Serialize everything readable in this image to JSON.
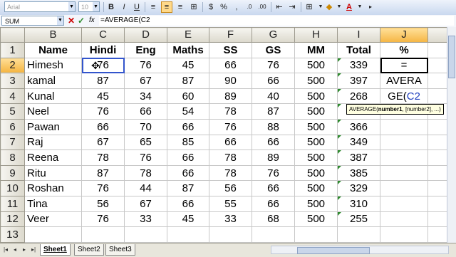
{
  "toolbar": {
    "font_name": "Arial",
    "font_size": "10",
    "bold": "B",
    "italic": "I",
    "underline": "U",
    "percent": "%",
    "comma": ",",
    "font_color_letter": "A"
  },
  "formula_bar": {
    "name_box": "SUM",
    "cancel": "✕",
    "enter": "✓",
    "fx": "fx",
    "formula": "=AVERAGE(C2"
  },
  "grid": {
    "columns": [
      "B",
      "C",
      "D",
      "E",
      "F",
      "G",
      "H",
      "I",
      "J"
    ],
    "headers": [
      "Name",
      "Hindi",
      "Eng",
      "Maths",
      "SS",
      "GS",
      "MM",
      "Total",
      "%"
    ],
    "rows": [
      {
        "num": "2",
        "name": "Himesh",
        "hindi": "76",
        "eng": "76",
        "maths": "45",
        "ss": "66",
        "gs": "76",
        "mm": "500",
        "total": "339"
      },
      {
        "num": "3",
        "name": "kamal",
        "hindi": "87",
        "eng": "67",
        "maths": "87",
        "ss": "90",
        "gs": "66",
        "mm": "500",
        "total": "397"
      },
      {
        "num": "4",
        "name": "Kunal",
        "hindi": "45",
        "eng": "34",
        "maths": "60",
        "ss": "89",
        "gs": "40",
        "mm": "500",
        "total": "268"
      },
      {
        "num": "5",
        "name": "Neel",
        "hindi": "76",
        "eng": "66",
        "maths": "54",
        "ss": "78",
        "gs": "87",
        "mm": "500",
        "total": ""
      },
      {
        "num": "6",
        "name": "Pawan",
        "hindi": "66",
        "eng": "70",
        "maths": "66",
        "ss": "76",
        "gs": "88",
        "mm": "500",
        "total": "366"
      },
      {
        "num": "7",
        "name": "Raj",
        "hindi": "67",
        "eng": "65",
        "maths": "85",
        "ss": "66",
        "gs": "66",
        "mm": "500",
        "total": "349"
      },
      {
        "num": "8",
        "name": "Reena",
        "hindi": "78",
        "eng": "76",
        "maths": "66",
        "ss": "78",
        "gs": "89",
        "mm": "500",
        "total": "387"
      },
      {
        "num": "9",
        "name": "Ritu",
        "hindi": "87",
        "eng": "78",
        "maths": "66",
        "ss": "78",
        "gs": "76",
        "mm": "500",
        "total": "385"
      },
      {
        "num": "10",
        "name": "Roshan",
        "hindi": "76",
        "eng": "44",
        "maths": "87",
        "ss": "56",
        "gs": "66",
        "mm": "500",
        "total": "329"
      },
      {
        "num": "11",
        "name": "Tina",
        "hindi": "56",
        "eng": "67",
        "maths": "66",
        "ss": "55",
        "gs": "66",
        "mm": "500",
        "total": "310"
      },
      {
        "num": "12",
        "name": "Veer",
        "hindi": "76",
        "eng": "33",
        "maths": "45",
        "ss": "33",
        "gs": "68",
        "mm": "500",
        "total": "255"
      }
    ],
    "row_labels": [
      "1",
      "13"
    ],
    "editing": {
      "line1": "=",
      "line2": "AVERA",
      "line3_prefix": "GE(",
      "line3_ref": "C2"
    }
  },
  "tooltip": {
    "func": "AVERAGE(",
    "arg1": "number1",
    "rest": ", [number2], ...)"
  },
  "tabs": [
    "Sheet1",
    "Sheet2",
    "Sheet3"
  ]
}
